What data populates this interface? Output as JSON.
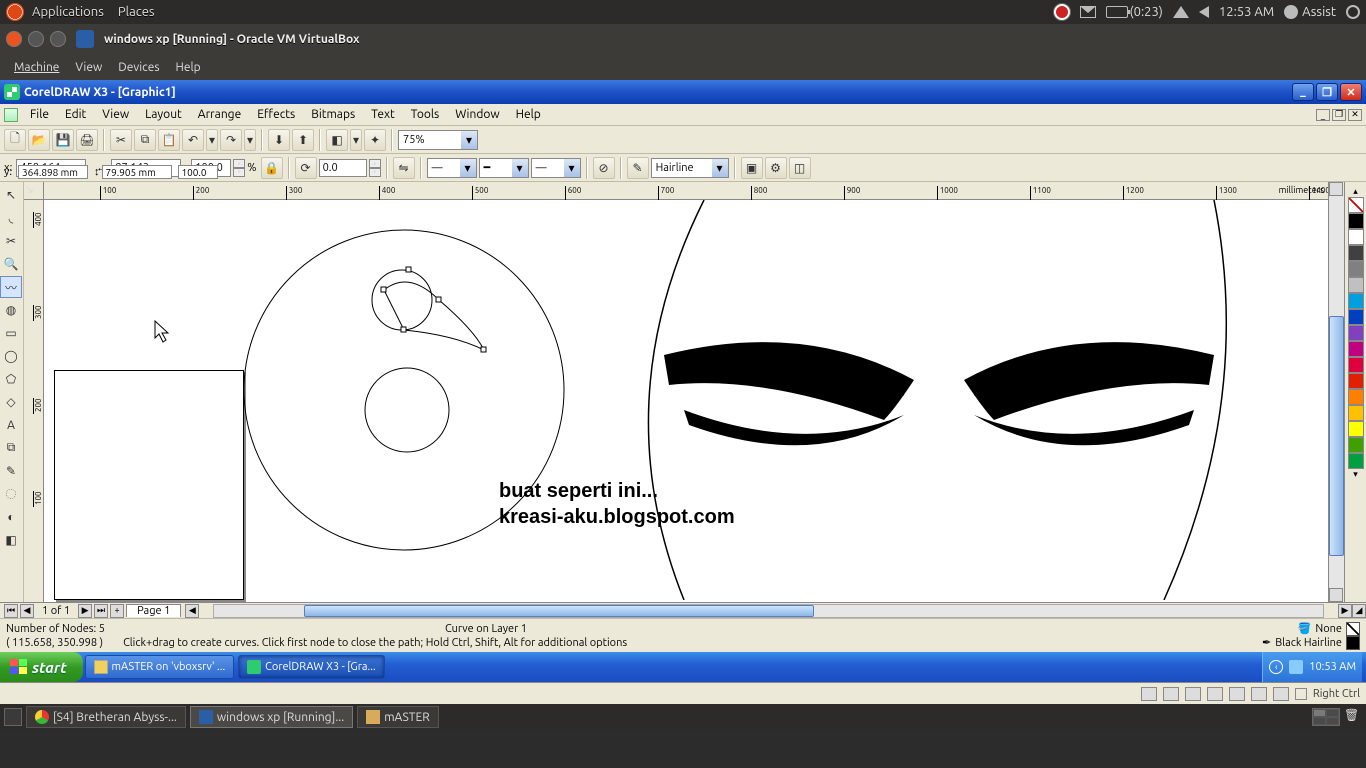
{
  "ubuntu_panel": {
    "menu": [
      "Applications",
      "Places"
    ],
    "battery_text": "(0:23)",
    "clock": "12:53 AM",
    "user": "Assist"
  },
  "virtualbox": {
    "title": "windows xp [Running] - Oracle VM VirtualBox",
    "menu": [
      "Machine",
      "View",
      "Devices",
      "Help"
    ],
    "hostkey": "Right Ctrl"
  },
  "coreldraw": {
    "title": "CorelDRAW X3 - [Graphic1]",
    "menu": [
      "File",
      "Edit",
      "View",
      "Layout",
      "Arrange",
      "Effects",
      "Bitmaps",
      "Text",
      "Tools",
      "Window",
      "Help"
    ],
    "zoom": "75%",
    "property_bar": {
      "x_label": "x:",
      "x": "458.164 mm",
      "y_label": "y:",
      "y": "364.898 mm",
      "w": "87.143 mm",
      "h": "79.905 mm",
      "sx": "100.0",
      "sy": "100.0",
      "pct": "%",
      "angle": "0.0",
      "outline_label": "Hairline"
    },
    "ruler_unit": "millimeters",
    "hruler_ticks": [
      100,
      200,
      300,
      400,
      500,
      600,
      700,
      800,
      900,
      1000,
      1100,
      1200,
      1300,
      1400
    ],
    "vruler_ticks": [
      100,
      200,
      300,
      400
    ],
    "page": {
      "counter": "1 of 1",
      "tab": "Page 1"
    },
    "canvas_text": {
      "line1": "buat seperti ini...",
      "line2": "kreasi-aku.blogspot.com"
    },
    "status": {
      "nodes": "Number of Nodes: 5",
      "layer": "Curve on Layer 1",
      "coords": "( 115.658, 350.998 )",
      "hint": "Click+drag to create curves. Click first node to close the path; Hold Ctrl, Shift, Alt for additional options",
      "fill": "None",
      "outline": "Black  Hairline"
    },
    "palette": [
      "#000000",
      "#ffffff",
      "#404040",
      "#808080",
      "#c0c0c0",
      "#00a0e0",
      "#0040c0",
      "#8040c0",
      "#c00080",
      "#e00040",
      "#e02000",
      "#ff8000",
      "#ffc000",
      "#ffff00",
      "#40a000",
      "#00a040"
    ]
  },
  "xp_taskbar": {
    "start": "start",
    "tasks": [
      {
        "label": "mASTER on 'vboxsrv' ...",
        "active": false
      },
      {
        "label": "CorelDRAW X3 - [Gra...",
        "active": true
      }
    ],
    "clock": "10:53 AM"
  },
  "ubuntu_bottom": {
    "tasks": [
      {
        "label": "[S4] Bretheran Abyss-...",
        "active": false
      },
      {
        "label": "windows xp [Running]...",
        "active": true
      },
      {
        "label": "mASTER",
        "active": false
      }
    ]
  }
}
